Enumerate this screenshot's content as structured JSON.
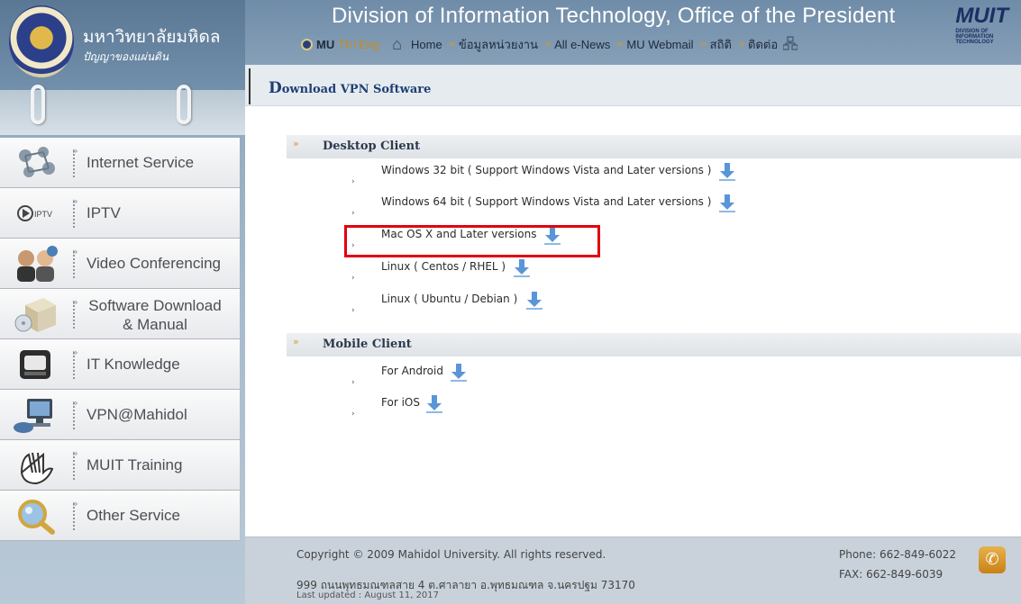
{
  "colors": {
    "accent_red": "#e2000f",
    "header_blue": "#6f8ca8",
    "title_blue": "#1d3f73",
    "lang_gold": "#c98b18"
  },
  "university": {
    "name_th": "มหาวิทยาลัยมหิดล",
    "motto_script": "ปัญญาของแผ่นดิน"
  },
  "header": {
    "title": "Division of Information Technology, Office of the President",
    "logo_text": "MUIT",
    "logo_subtext": "DIVISION OF INFORMATION TECHNOLOGY",
    "mu": "MU",
    "lang_th": "Th",
    "lang_sep": "/",
    "lang_en": "Eng",
    "links": [
      "Home",
      "ข้อมูลหน่วยงาน",
      "All e-News",
      "MU Webmail",
      "สถิติ",
      "ติดต่อ"
    ],
    "icons": {
      "home": "home-icon",
      "network": "network-icon"
    }
  },
  "sidebar": {
    "items": [
      {
        "label": "Internet Service",
        "icon": "network-icon"
      },
      {
        "label": "IPTV",
        "icon": "iptv-icon"
      },
      {
        "label": "Video Conferencing",
        "icon": "video-conference-icon"
      },
      {
        "label_1": "Software Download",
        "label_2": "& Manual",
        "icon": "software-box-icon"
      },
      {
        "label": "IT Knowledge",
        "icon": "book-icon"
      },
      {
        "label": "VPN@Mahidol",
        "icon": "computer-icon"
      },
      {
        "label": "MUIT Training",
        "icon": "hand-icon"
      },
      {
        "label": "Other Service",
        "icon": "magnifier-icon"
      }
    ]
  },
  "page": {
    "title_first": "D",
    "title_rest": "ownload VPN Software"
  },
  "main": {
    "sections": [
      {
        "title": "Desktop Client",
        "items": [
          "Windows 32 bit ( Support Windows Vista and Later versions )",
          "Windows 64 bit ( Support Windows Vista and Later versions )",
          "Mac OS X and Later versions",
          "Linux ( Centos / RHEL )",
          "Linux ( Ubuntu / Debian )"
        ]
      },
      {
        "title": "Mobile Client",
        "items": [
          "For Android",
          "For iOS"
        ]
      }
    ],
    "highlighted_item": "Mac OS X and Later versions"
  },
  "footer": {
    "copyright": "Copyright © 2009 Mahidol University. All rights reserved.",
    "address": "999 ถนนพุทธมณฑลสาย 4 ต.ศาลายา อ.พุทธมณฑล จ.นครปฐม 73170",
    "last_updated": "Last updated : August 11, 2017",
    "phone": "Phone: 662-849-6022",
    "fax": "FAX:   662-849-6039"
  }
}
